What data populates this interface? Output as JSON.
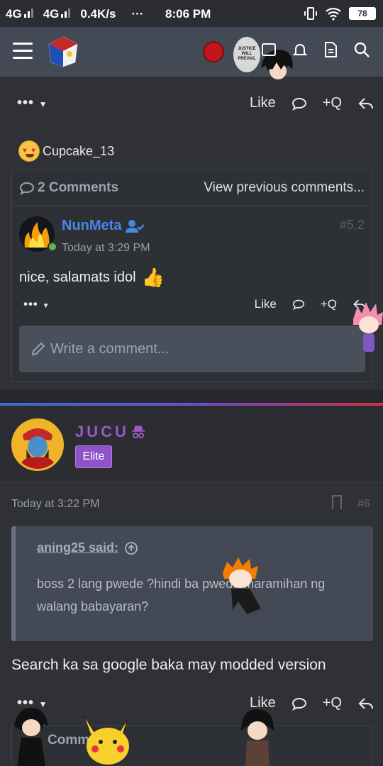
{
  "statusbar": {
    "net1": "4G",
    "net2": "4G",
    "speed": "0.4K/s",
    "more": "···",
    "time": "8:06 PM",
    "battery": "78"
  },
  "topbar": {
    "justice_text": "JUSTICE WILL PREVAIL"
  },
  "post_actions": {
    "more": "•••",
    "like": "Like",
    "quote": "+Q"
  },
  "reaction_user": "Cupcake_13",
  "comments": {
    "count_label": "2 Comments",
    "view_previous": "View previous comments...",
    "comment": {
      "author": "NunMeta",
      "post_number": "#5.2",
      "time": "Today at 3:29 PM",
      "text": "nice, salamats idol"
    },
    "comment_actions": {
      "more": "•••",
      "like": "Like",
      "quote": "+Q"
    },
    "write_placeholder": "Write a comment..."
  },
  "post": {
    "author": "JUCU",
    "badge": "Elite",
    "time": "Today at 3:22 PM",
    "post_number": "#6",
    "quote": {
      "author": "aning25 said:",
      "text": "boss 2 lang pwede ?hindi ba pwede maramihan ng walang babayaran?"
    },
    "body": "Search ka sa google baka may modded version",
    "actions": {
      "more": "•••",
      "like": "Like",
      "quote": "+Q"
    },
    "comments_partial": "Comm"
  },
  "colors": {
    "accent_blue": "#4b86e8",
    "accent_purple": "#9b59c8",
    "elite_badge": "#8e53c8"
  }
}
